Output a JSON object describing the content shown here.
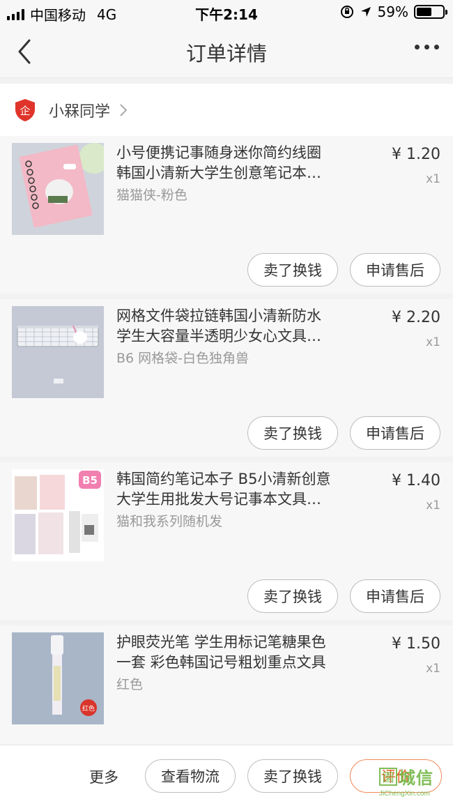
{
  "status_bar": {
    "carrier": "中国移动",
    "network": "4G",
    "time": "下午2:14",
    "battery": "59%",
    "battery_level": 0.59
  },
  "nav": {
    "title": "订单详情"
  },
  "shop": {
    "name": "小槑同学"
  },
  "items": [
    {
      "title": "小号便携记事随身迷你简约线圈\n韩国小清新大学生创意笔记本…",
      "sku": "猫猫侠-粉色",
      "price": "¥ 1.20",
      "qty": "x1",
      "sell_label": "卖了换钱",
      "service_label": "申请售后"
    },
    {
      "title": "网格文件袋拉链韩国小清新防水\n学生大容量半透明少女心文具…",
      "sku": "B6 网格袋-白色独角兽",
      "price": "¥ 2.20",
      "qty": "x1",
      "sell_label": "卖了换钱",
      "service_label": "申请售后"
    },
    {
      "title": "韩国简约笔记本子 B5小清新创意\n大学生用批发大号记事本文具…",
      "sku": "猫和我系列随机发",
      "price": "¥ 1.40",
      "qty": "x1",
      "sell_label": "卖了换钱",
      "service_label": "申请售后",
      "thumb_badge": "B5"
    },
    {
      "title": "护眼荧光笔 学生用标记笔糖果色\n一套 彩色韩国记号粗划重点文具",
      "sku": "红色",
      "price": "¥ 1.50",
      "qty": "x1",
      "thumb_badge": "红色"
    }
  ],
  "bottom_bar": {
    "more": "更多",
    "logistics": "查看物流",
    "sell": "卖了换钱",
    "review": "评价"
  },
  "watermark": {
    "text": "城信",
    "url": "JiChengXin.com"
  }
}
